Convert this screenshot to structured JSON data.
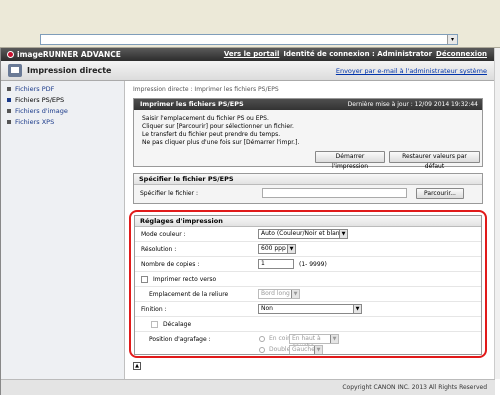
{
  "header": {
    "brand": "imageRUNNER ADVANCE",
    "portal_link": "Vers le portail",
    "login_label": "Identité de connexion : Administrator",
    "logout_link": "Déconnexion"
  },
  "titlebar": {
    "title": "Impression directe",
    "send_link": "Envoyer par e-mail à l'administrateur système"
  },
  "sidebar": {
    "items": [
      {
        "label": "Fichiers PDF"
      },
      {
        "label": "Fichiers PS/EPS"
      },
      {
        "label": "Fichiers d'image"
      },
      {
        "label": "Fichiers XPS"
      }
    ]
  },
  "breadcrumb": "Impression directe : Imprimer les fichiers PS/EPS",
  "info": {
    "title": "Imprimer les fichiers PS/EPS",
    "updated": "Dernière mise à jour : 12/09 2014 19:32:44",
    "lines": [
      "Saisir l'emplacement du fichier PS ou EPS.",
      "Cliquer sur [Parcourir] pour sélectionner un fichier.",
      "Le transfert du fichier peut prendre du temps.",
      "Ne pas cliquer plus d'une fois sur [Démarrer l'impr.]."
    ],
    "start_button": "Démarrer l'impression",
    "reset_button": "Restaurer valeurs par défaut"
  },
  "file": {
    "section_title": "Spécifier le fichier PS/EPS",
    "label": "Spécifier le fichier :",
    "value": "",
    "browse_button": "Parcourir..."
  },
  "settings": {
    "section_title": "Réglages d'impression",
    "color_mode_label": "Mode couleur :",
    "color_mode_value": "Auto (Couleur/Noir et blanc)",
    "resolution_label": "Résolution :",
    "resolution_value": "600 ppp",
    "copies_label": "Nombre de copies :",
    "copies_value": "1",
    "copies_range": "(1- 9999)",
    "duplex_label": "Imprimer recto verso",
    "binding_label": "Emplacement de la reliure",
    "binding_value": "Bord long",
    "finishing_label": "Finition :",
    "finishing_value": "Non",
    "offset_label": "Décalage",
    "staple_label": "Position d'agrafage :",
    "staple_corner_label": "En coin",
    "staple_corner_value": "En haut à gauche",
    "staple_double_label": "Double",
    "staple_double_value": "Gauche"
  },
  "footer": {
    "copyright": "Copyright CANON INC. 2013 All Rights Reserved"
  },
  "colors": {
    "highlight": "#e11a1a",
    "header_dark": "#333333",
    "link": "#0033aa"
  }
}
